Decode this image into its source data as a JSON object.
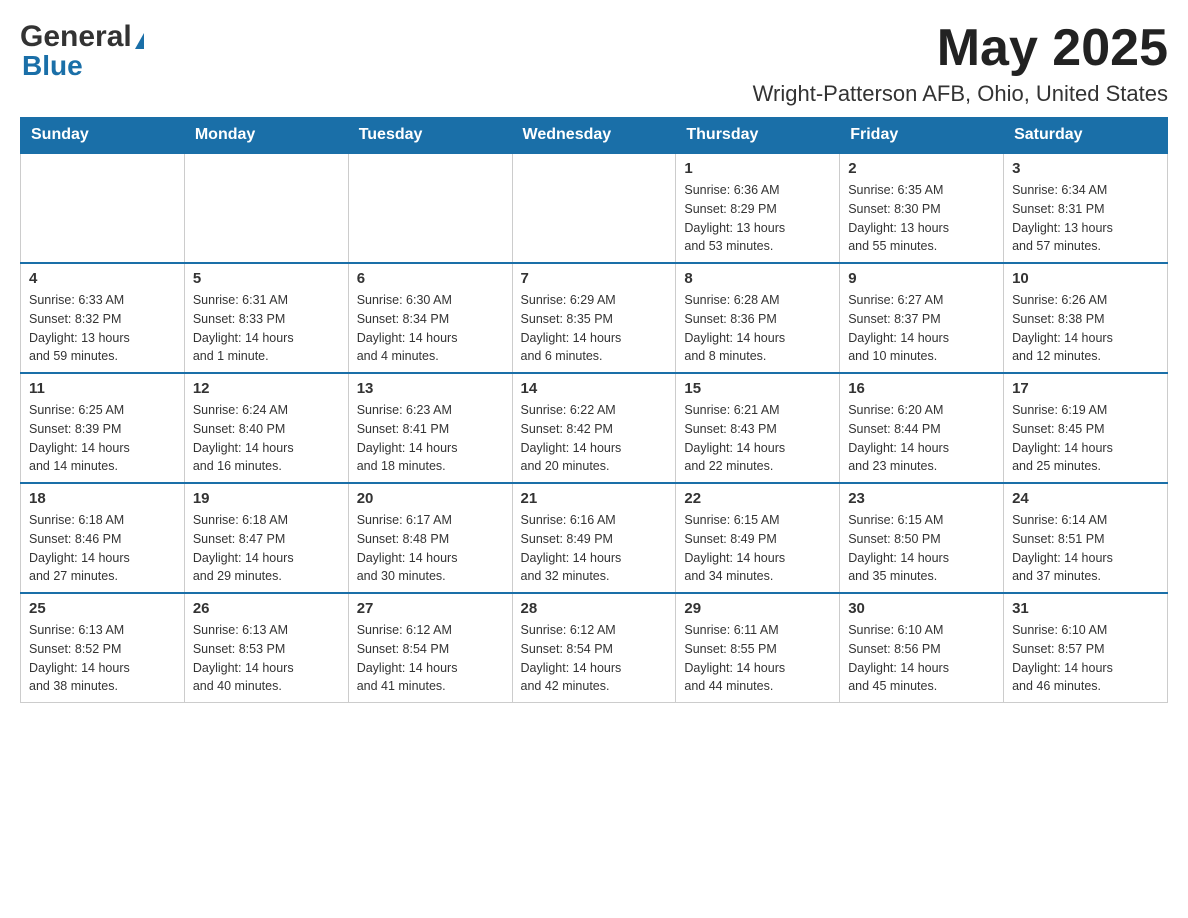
{
  "header": {
    "logo_line1": "General",
    "logo_triangle": "▶",
    "logo_line2": "Blue",
    "month_title": "May 2025",
    "location": "Wright-Patterson AFB, Ohio, United States"
  },
  "calendar": {
    "days_of_week": [
      "Sunday",
      "Monday",
      "Tuesday",
      "Wednesday",
      "Thursday",
      "Friday",
      "Saturday"
    ],
    "weeks": [
      [
        {
          "day": "",
          "info": ""
        },
        {
          "day": "",
          "info": ""
        },
        {
          "day": "",
          "info": ""
        },
        {
          "day": "",
          "info": ""
        },
        {
          "day": "1",
          "info": "Sunrise: 6:36 AM\nSunset: 8:29 PM\nDaylight: 13 hours\nand 53 minutes."
        },
        {
          "day": "2",
          "info": "Sunrise: 6:35 AM\nSunset: 8:30 PM\nDaylight: 13 hours\nand 55 minutes."
        },
        {
          "day": "3",
          "info": "Sunrise: 6:34 AM\nSunset: 8:31 PM\nDaylight: 13 hours\nand 57 minutes."
        }
      ],
      [
        {
          "day": "4",
          "info": "Sunrise: 6:33 AM\nSunset: 8:32 PM\nDaylight: 13 hours\nand 59 minutes."
        },
        {
          "day": "5",
          "info": "Sunrise: 6:31 AM\nSunset: 8:33 PM\nDaylight: 14 hours\nand 1 minute."
        },
        {
          "day": "6",
          "info": "Sunrise: 6:30 AM\nSunset: 8:34 PM\nDaylight: 14 hours\nand 4 minutes."
        },
        {
          "day": "7",
          "info": "Sunrise: 6:29 AM\nSunset: 8:35 PM\nDaylight: 14 hours\nand 6 minutes."
        },
        {
          "day": "8",
          "info": "Sunrise: 6:28 AM\nSunset: 8:36 PM\nDaylight: 14 hours\nand 8 minutes."
        },
        {
          "day": "9",
          "info": "Sunrise: 6:27 AM\nSunset: 8:37 PM\nDaylight: 14 hours\nand 10 minutes."
        },
        {
          "day": "10",
          "info": "Sunrise: 6:26 AM\nSunset: 8:38 PM\nDaylight: 14 hours\nand 12 minutes."
        }
      ],
      [
        {
          "day": "11",
          "info": "Sunrise: 6:25 AM\nSunset: 8:39 PM\nDaylight: 14 hours\nand 14 minutes."
        },
        {
          "day": "12",
          "info": "Sunrise: 6:24 AM\nSunset: 8:40 PM\nDaylight: 14 hours\nand 16 minutes."
        },
        {
          "day": "13",
          "info": "Sunrise: 6:23 AM\nSunset: 8:41 PM\nDaylight: 14 hours\nand 18 minutes."
        },
        {
          "day": "14",
          "info": "Sunrise: 6:22 AM\nSunset: 8:42 PM\nDaylight: 14 hours\nand 20 minutes."
        },
        {
          "day": "15",
          "info": "Sunrise: 6:21 AM\nSunset: 8:43 PM\nDaylight: 14 hours\nand 22 minutes."
        },
        {
          "day": "16",
          "info": "Sunrise: 6:20 AM\nSunset: 8:44 PM\nDaylight: 14 hours\nand 23 minutes."
        },
        {
          "day": "17",
          "info": "Sunrise: 6:19 AM\nSunset: 8:45 PM\nDaylight: 14 hours\nand 25 minutes."
        }
      ],
      [
        {
          "day": "18",
          "info": "Sunrise: 6:18 AM\nSunset: 8:46 PM\nDaylight: 14 hours\nand 27 minutes."
        },
        {
          "day": "19",
          "info": "Sunrise: 6:18 AM\nSunset: 8:47 PM\nDaylight: 14 hours\nand 29 minutes."
        },
        {
          "day": "20",
          "info": "Sunrise: 6:17 AM\nSunset: 8:48 PM\nDaylight: 14 hours\nand 30 minutes."
        },
        {
          "day": "21",
          "info": "Sunrise: 6:16 AM\nSunset: 8:49 PM\nDaylight: 14 hours\nand 32 minutes."
        },
        {
          "day": "22",
          "info": "Sunrise: 6:15 AM\nSunset: 8:49 PM\nDaylight: 14 hours\nand 34 minutes."
        },
        {
          "day": "23",
          "info": "Sunrise: 6:15 AM\nSunset: 8:50 PM\nDaylight: 14 hours\nand 35 minutes."
        },
        {
          "day": "24",
          "info": "Sunrise: 6:14 AM\nSunset: 8:51 PM\nDaylight: 14 hours\nand 37 minutes."
        }
      ],
      [
        {
          "day": "25",
          "info": "Sunrise: 6:13 AM\nSunset: 8:52 PM\nDaylight: 14 hours\nand 38 minutes."
        },
        {
          "day": "26",
          "info": "Sunrise: 6:13 AM\nSunset: 8:53 PM\nDaylight: 14 hours\nand 40 minutes."
        },
        {
          "day": "27",
          "info": "Sunrise: 6:12 AM\nSunset: 8:54 PM\nDaylight: 14 hours\nand 41 minutes."
        },
        {
          "day": "28",
          "info": "Sunrise: 6:12 AM\nSunset: 8:54 PM\nDaylight: 14 hours\nand 42 minutes."
        },
        {
          "day": "29",
          "info": "Sunrise: 6:11 AM\nSunset: 8:55 PM\nDaylight: 14 hours\nand 44 minutes."
        },
        {
          "day": "30",
          "info": "Sunrise: 6:10 AM\nSunset: 8:56 PM\nDaylight: 14 hours\nand 45 minutes."
        },
        {
          "day": "31",
          "info": "Sunrise: 6:10 AM\nSunset: 8:57 PM\nDaylight: 14 hours\nand 46 minutes."
        }
      ]
    ]
  }
}
